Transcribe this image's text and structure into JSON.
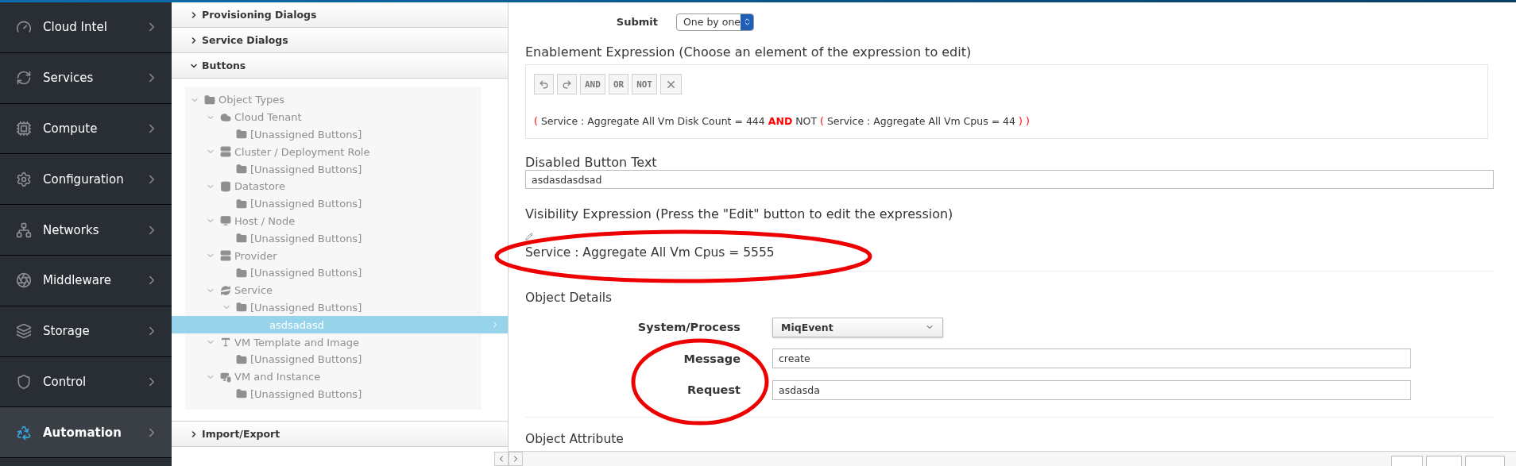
{
  "nav": {
    "items": [
      {
        "label": "Cloud Intel",
        "kind": "dashboard",
        "selected": false
      },
      {
        "label": "Services",
        "kind": "services",
        "selected": false
      },
      {
        "label": "Compute",
        "kind": "chip",
        "selected": false
      },
      {
        "label": "Configuration",
        "kind": "gear",
        "selected": false
      },
      {
        "label": "Networks",
        "kind": "network",
        "selected": false
      },
      {
        "label": "Middleware",
        "kind": "middleware",
        "selected": false
      },
      {
        "label": "Storage",
        "kind": "storage",
        "selected": false
      },
      {
        "label": "Control",
        "kind": "shield",
        "selected": false
      },
      {
        "label": "Automation",
        "kind": "recycle",
        "selected": true
      }
    ]
  },
  "accordion": {
    "sections_top": [
      {
        "label": "Provisioning Dialogs",
        "expanded": false
      },
      {
        "label": "Service Dialogs",
        "expanded": false
      },
      {
        "label": "Buttons",
        "expanded": true
      }
    ],
    "tree": {
      "disabled": true,
      "items": [
        {
          "label": "Object Types",
          "kind": "folder",
          "expanded": true,
          "selected": false,
          "children": [
            {
              "label": "Cloud Tenant",
              "kind": "cloud",
              "expanded": true,
              "selected": false,
              "children": [
                {
                  "label": "[Unassigned Buttons]",
                  "kind": "folder",
                  "selected": false
                }
              ]
            },
            {
              "label": "Cluster / Deployment Role",
              "kind": "server",
              "expanded": true,
              "selected": false,
              "children": [
                {
                  "label": "[Unassigned Buttons]",
                  "kind": "folder",
                  "selected": false
                }
              ]
            },
            {
              "label": "Datastore",
              "kind": "database",
              "expanded": true,
              "selected": false,
              "children": [
                {
                  "label": "[Unassigned Buttons]",
                  "kind": "folder",
                  "selected": false
                }
              ]
            },
            {
              "label": "Host / Node",
              "kind": "monitor",
              "expanded": true,
              "selected": false,
              "children": [
                {
                  "label": "[Unassigned Buttons]",
                  "kind": "folder",
                  "selected": false
                }
              ]
            },
            {
              "label": "Provider",
              "kind": "server",
              "expanded": true,
              "selected": false,
              "children": [
                {
                  "label": "[Unassigned Buttons]",
                  "kind": "folder",
                  "selected": false
                }
              ]
            },
            {
              "label": "Service",
              "kind": "service",
              "expanded": true,
              "selected": false,
              "children": [
                {
                  "label": "[Unassigned Buttons]",
                  "kind": "folder",
                  "expanded": true,
                  "selected": false,
                  "children": [
                    {
                      "label": "asdsadasd",
                      "selected": true
                    }
                  ]
                }
              ]
            },
            {
              "label": "VM Template and Image",
              "kind": "template",
              "expanded": true,
              "selected": false,
              "children": [
                {
                  "label": "[Unassigned Buttons]",
                  "kind": "folder",
                  "selected": false
                }
              ]
            },
            {
              "label": "VM and Instance",
              "kind": "vm",
              "expanded": true,
              "selected": false,
              "children": [
                {
                  "label": "[Unassigned Buttons]",
                  "kind": "folder",
                  "selected": false
                }
              ]
            }
          ]
        }
      ]
    },
    "sections_bottom": [
      {
        "label": "Import/Export",
        "expanded": false
      }
    ]
  },
  "form": {
    "submit": {
      "label": "Submit",
      "value": "One by one"
    },
    "enablement": {
      "heading": "Enablement Expression (Choose an element of the expression to edit)",
      "toolbar": [
        {
          "kind": "undo"
        },
        {
          "kind": "redo"
        },
        {
          "kind": "text",
          "label": "AND"
        },
        {
          "kind": "text",
          "label": "OR"
        },
        {
          "kind": "text",
          "label": "NOT"
        },
        {
          "kind": "remove"
        }
      ],
      "expression": [
        {
          "kind": "paren",
          "text": "("
        },
        {
          "kind": "term",
          "text": "Service : Aggregate All Vm Disk Count = 444"
        },
        {
          "kind": "operator",
          "text": "AND"
        },
        {
          "kind": "term",
          "text": "NOT"
        },
        {
          "kind": "paren",
          "text": "("
        },
        {
          "kind": "term",
          "text": "Service : Aggregate All Vm Cpus = 44"
        },
        {
          "kind": "paren",
          "text": ")"
        },
        {
          "kind": "paren",
          "text": ")"
        }
      ]
    },
    "disabled_text": {
      "label": "Disabled Button Text",
      "value": "asdasdasdsad"
    },
    "visibility": {
      "heading": "Visibility Expression (Press the \"Edit\" button to edit the expression)",
      "expression": "Service : Aggregate All Vm Cpus = 5555"
    },
    "object_details": {
      "heading": "Object Details",
      "fields": [
        {
          "kind": "select",
          "label": "System/Process",
          "value": "MiqEvent"
        },
        {
          "kind": "input",
          "label": "Message",
          "value": "create"
        },
        {
          "kind": "input",
          "label": "Request",
          "value": "asdasda"
        }
      ]
    },
    "object_attribute": {
      "heading": "Object Attribute"
    }
  }
}
